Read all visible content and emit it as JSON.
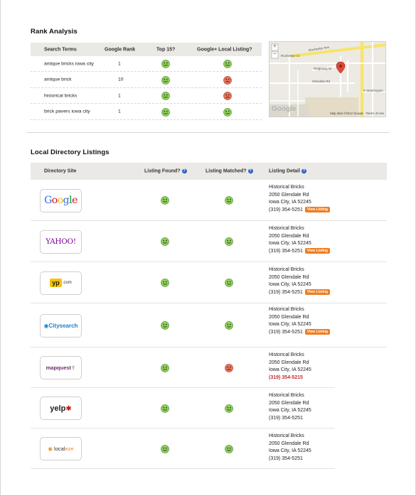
{
  "rank": {
    "title": "Rank Analysis",
    "headers": [
      "Search Terms",
      "Google Rank",
      "Top 15?",
      "Google+ Local Listing?"
    ],
    "rows": [
      {
        "term": "antique bricks iowa city",
        "rank": "1",
        "top15": "good",
        "local": "good"
      },
      {
        "term": "antique brick",
        "rank": "10",
        "top15": "good",
        "local": "bad"
      },
      {
        "term": "historical bricks",
        "rank": "1",
        "top15": "good",
        "local": "bad"
      },
      {
        "term": "brick pavers iowa city",
        "rank": "1",
        "top15": "good",
        "local": "good"
      }
    ]
  },
  "map": {
    "streets": [
      "Rochester Ct",
      "Rochester Ave",
      "Ridgeway Dr",
      "Glendale Rd",
      "E Washington",
      "Juniper Rd",
      "Mayflower",
      "Whiting",
      "Parsons",
      "Clapp",
      "Fairview",
      "Ridgeway"
    ],
    "attribution": "Map data ©2012 Google - Terms of Use",
    "zoom_in": "+",
    "zoom_out": "−",
    "logo": "Google"
  },
  "directory": {
    "title": "Local Directory Listings",
    "headers": {
      "site": "Directory Site",
      "found": "Listing Found?",
      "matched": "Listing Matched?",
      "detail": "Listing Detail"
    },
    "view_label": "View Listing",
    "rows": [
      {
        "site": "Google",
        "found": "good",
        "matched": "good",
        "name": "Historical Bricks",
        "street": "2050 Glendale Rd",
        "city": "Iowa City, IA 52245",
        "phone": "(319) 354-5251",
        "view": true,
        "phone_bad": false
      },
      {
        "site": "YAHOO!",
        "found": "good",
        "matched": "good",
        "name": "Historical Bricks",
        "street": "2050 Glendale Rd",
        "city": "Iowa City, IA 52245",
        "phone": "(319) 354-5251",
        "view": true,
        "phone_bad": false
      },
      {
        "site": "yp.com",
        "found": "good",
        "matched": "good",
        "name": "Historical Bricks",
        "street": "2050 Glendale Rd",
        "city": "Iowa City, IA 52245",
        "phone": "(319) 354-5251",
        "view": true,
        "phone_bad": false
      },
      {
        "site": "Citysearch",
        "found": "good",
        "matched": "good",
        "name": "Historical Bricks",
        "street": "2050 Glendale Rd",
        "city": "Iowa City, IA 52245",
        "phone": "(319) 354-5251",
        "view": true,
        "phone_bad": false
      },
      {
        "site": "mapquest",
        "found": "good",
        "matched": "bad",
        "name": "Historical Bricks",
        "street": "2050 Glendale Rd",
        "city": "Iowa City, IA 52245",
        "phone": "(319) 354-5215",
        "view": false,
        "phone_bad": true
      },
      {
        "site": "yelp",
        "found": "good",
        "matched": "good",
        "name": "Historical Bricks",
        "street": "2050 Glendale Rd",
        "city": "Iowa City, IA 52245",
        "phone": "(319) 354-5251",
        "view": false,
        "phone_bad": false
      },
      {
        "site": "localeze",
        "found": "good",
        "matched": "good",
        "name": "Historical Bricks",
        "street": "2050 Glendale Rd",
        "city": "Iowa City, IA 52245",
        "phone": "(319) 354-5251",
        "view": false,
        "phone_bad": false
      }
    ]
  },
  "colors": {
    "good": "#8fcf5e",
    "bad": "#e7735c"
  }
}
